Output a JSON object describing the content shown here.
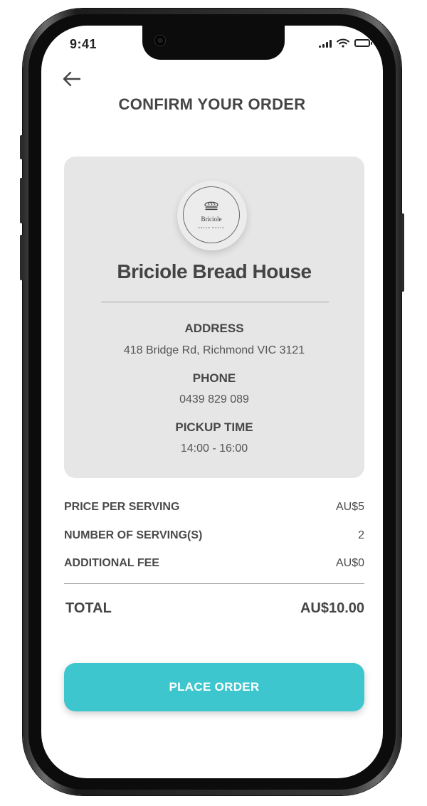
{
  "status_bar": {
    "time": "9:41"
  },
  "header": {
    "back_icon": "arrow-left-icon",
    "title": "CONFIRM YOUR ORDER"
  },
  "store": {
    "logo_name": "Briciole",
    "logo_subtitle": "BREAD HOUSE",
    "name": "Briciole Bread House",
    "address_label": "ADDRESS",
    "address": "418 Bridge Rd, Richmond VIC 3121",
    "phone_label": "PHONE",
    "phone": "0439 829 089",
    "pickup_label": "PICKUP TIME",
    "pickup_time": "14:00 - 16:00"
  },
  "summary": {
    "rows": [
      {
        "label": "PRICE PER SERVING",
        "value": "AU$5"
      },
      {
        "label": "NUMBER OF SERVING(S)",
        "value": "2"
      },
      {
        "label": "ADDITIONAL FEE",
        "value": "AU$0"
      }
    ],
    "total_label": "TOTAL",
    "total_value": "AU$10.00"
  },
  "actions": {
    "place_order_label": "PLACE ORDER"
  },
  "colors": {
    "accent": "#3ec6cf",
    "card_bg": "#e6e6e6",
    "text_dark": "#454545"
  }
}
